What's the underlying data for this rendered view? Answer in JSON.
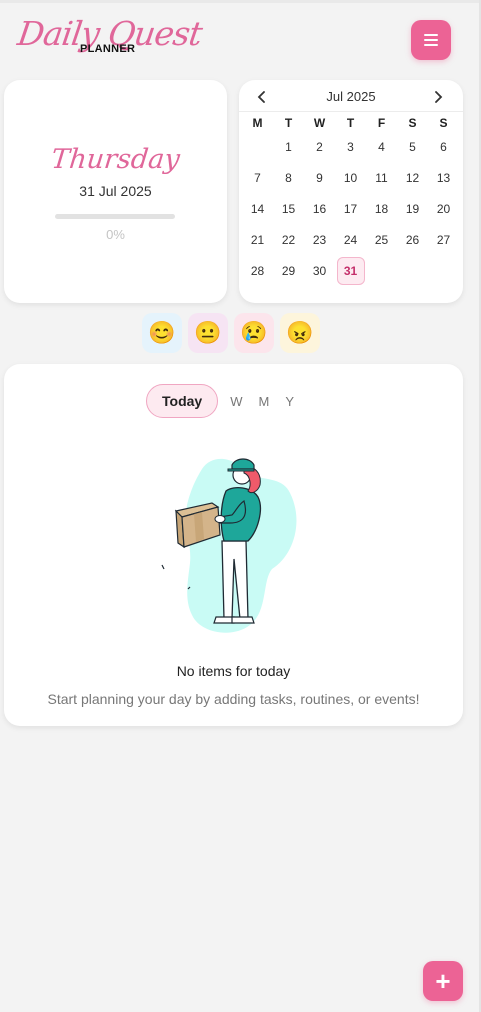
{
  "app": {
    "logo_script": "Daily Quest",
    "logo_sub": "PLANNER",
    "menu_icon": "hamburger-menu-icon"
  },
  "day_card": {
    "weekday": "Thursday",
    "date": "31 Jul 2025",
    "progress_value": 0,
    "progress_label": "0%"
  },
  "calendar": {
    "title": "Jul 2025",
    "prev_icon": "chevron-left-icon",
    "next_icon": "chevron-right-icon",
    "weekdays": [
      "M",
      "T",
      "W",
      "T",
      "F",
      "S",
      "S"
    ],
    "weeks": [
      [
        "",
        "1",
        "2",
        "3",
        "4",
        "5",
        "6"
      ],
      [
        "7",
        "8",
        "9",
        "10",
        "11",
        "12",
        "13"
      ],
      [
        "14",
        "15",
        "16",
        "17",
        "18",
        "19",
        "20"
      ],
      [
        "21",
        "22",
        "23",
        "24",
        "25",
        "26",
        "27"
      ],
      [
        "28",
        "29",
        "30",
        "31",
        "",
        "",
        ""
      ]
    ],
    "selected_day": "31"
  },
  "moods": [
    {
      "name": "happy",
      "emoji": "😊"
    },
    {
      "name": "neutral",
      "emoji": "😐"
    },
    {
      "name": "sad",
      "emoji": "😢"
    },
    {
      "name": "angry",
      "emoji": "😠"
    }
  ],
  "tabs": [
    {
      "label": "Today",
      "active": true
    },
    {
      "label": "W",
      "active": false
    },
    {
      "label": "M",
      "active": false
    },
    {
      "label": "Y",
      "active": false
    }
  ],
  "empty_state": {
    "title": "No items for today",
    "subtitle": "Start planning your day by adding tasks, routines, or events!"
  },
  "fab": {
    "label": "+",
    "icon": "plus-icon"
  },
  "colors": {
    "accent": "#ec6395",
    "accent_light": "#fdeaf0",
    "background": "#f3f3f3",
    "blob": "#c9fbf5",
    "figure_teal": "#1ea79a",
    "hair": "#ef5a6a",
    "box": "#d2b48c"
  }
}
